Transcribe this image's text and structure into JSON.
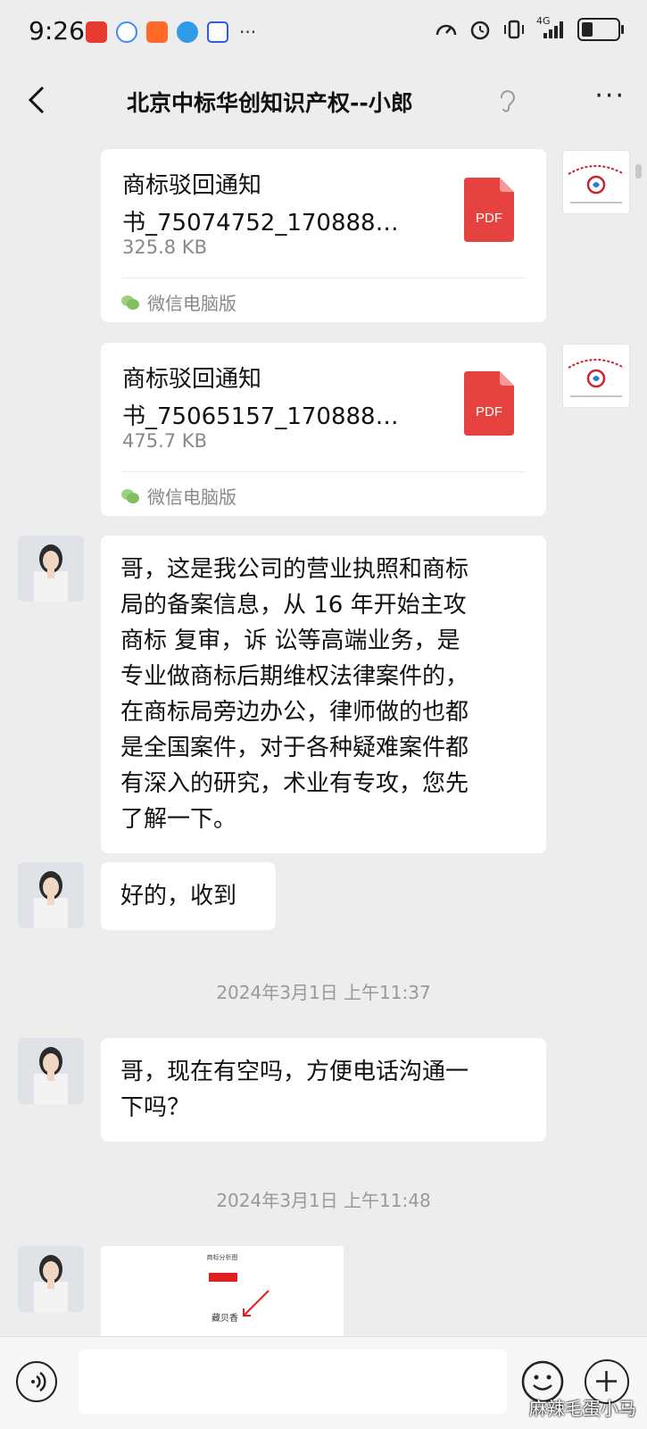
{
  "status_bar": {
    "time": "9:26",
    "network_label": "4G",
    "app_icons": [
      "news-app-icon",
      "chat-app-icon",
      "shopping-app-icon",
      "browser-app-icon",
      "baidu-app-icon"
    ],
    "more": "···"
  },
  "header": {
    "title": "北京中标华创知识产权--小郎",
    "back_icon": "chevron-left-icon",
    "more": "···"
  },
  "messages": {
    "file1": {
      "name_line1": "商标驳回通知",
      "name_line2": "书_75074752_170888…",
      "size": "325.8 KB",
      "source": "微信电脑版",
      "file_type": "PDF"
    },
    "file2": {
      "name_line1": "商标驳回通知",
      "name_line2": "书_75065157_170888…",
      "size": "475.7 KB",
      "source": "微信电脑版",
      "file_type": "PDF"
    },
    "text1": {
      "lines": [
        "哥，这是我公司的营业执照和商标",
        "局的备案信息，从 16 年开始主攻",
        "商标 复审，诉 讼等高端业务，是",
        "专业做商标后期维权法律案件的，",
        "在商标局旁边办公，律师做的也都",
        "是全国案件，对于各种疑难案件都",
        "有深入的研究，术业有专攻，您先",
        "了解一下。"
      ]
    },
    "text2": "好的，收到",
    "timestamp1": "2024年3月1日 上午11:37",
    "text3": {
      "lines": [
        "哥，现在有空吗，方便电话沟通一",
        "下吗？"
      ]
    },
    "timestamp2": "2024年3月1日 上午11:48",
    "image": {
      "title": "商标分析图",
      "caption": "藏贝香"
    }
  },
  "input_bar": {
    "voice_icon": "voice-icon",
    "emoji_icon": "emoji-icon",
    "plus_icon": "plus-icon"
  },
  "watermark": "麻辣毛蛋小马",
  "colors": {
    "background": "#ededed",
    "bubble": "#ffffff",
    "pdf_red": "#e64340",
    "timestamp": "#999999"
  }
}
